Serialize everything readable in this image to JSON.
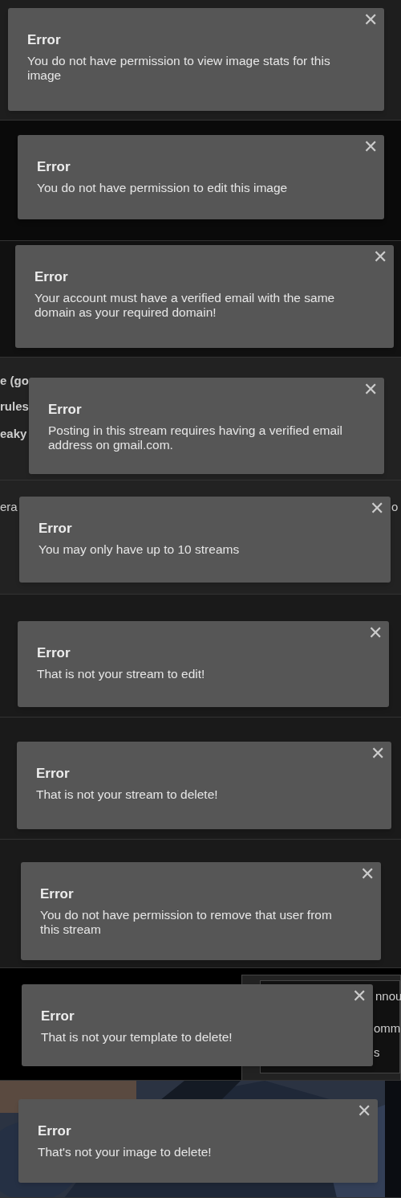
{
  "panels": [
    {
      "kind": "plain",
      "dialog": {
        "title": "Error",
        "message": "You do not have permission to view image stats for this image",
        "close": "✕"
      }
    },
    {
      "kind": "plain",
      "dialog": {
        "title": "Error",
        "message": "You do not have permission to edit this image",
        "close": "✕"
      }
    },
    {
      "kind": "plain",
      "dialog": {
        "title": "Error",
        "message": "Your account must have a verified email with the same domain as your required domain!",
        "close": "✕"
      }
    },
    {
      "kind": "plain",
      "background_texts": [
        "e (go",
        "rules",
        "eaky"
      ],
      "dialog": {
        "title": "Error",
        "message": "Posting in this stream requires having a verified email address on gmail.com.",
        "close": "✕"
      }
    },
    {
      "kind": "plain",
      "background_texts": [
        "era",
        "o"
      ],
      "dialog": {
        "title": "Error",
        "message": "You may only have up to 10 streams",
        "close": "✕"
      }
    },
    {
      "kind": "plain",
      "dialog": {
        "title": "Error",
        "message": "That is not your stream to edit!",
        "close": "✕"
      }
    },
    {
      "kind": "plain",
      "dialog": {
        "title": "Error",
        "message": "That is not your stream to delete!",
        "close": "✕"
      }
    },
    {
      "kind": "plain",
      "dialog": {
        "title": "Error",
        "message": "You do not have permission to remove that user from this stream",
        "close": "✕"
      }
    },
    {
      "kind": "menu",
      "background_texts": [
        "nnou",
        "omm",
        "s"
      ],
      "dialog": {
        "title": "Error",
        "message": "That is not your template to delete!",
        "close": "✕"
      }
    },
    {
      "kind": "picture",
      "dialog": {
        "title": "Error",
        "message": "That's not your image to delete!",
        "close": "✕"
      }
    }
  ]
}
